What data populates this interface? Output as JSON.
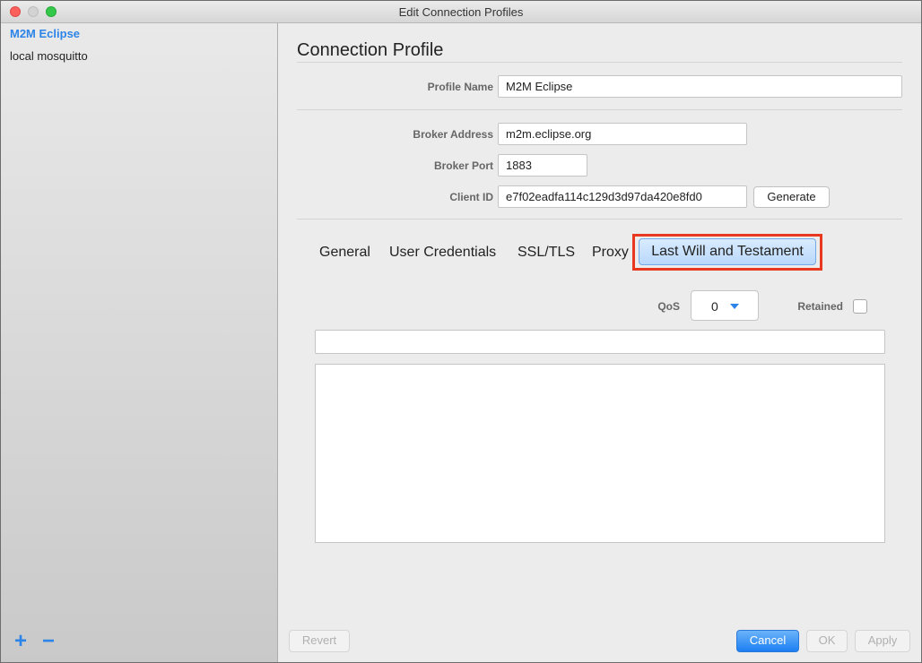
{
  "window": {
    "title": "Edit Connection Profiles"
  },
  "sidebar": {
    "items": [
      {
        "label": "M2M Eclipse",
        "selected": true
      },
      {
        "label": "local mosquitto",
        "selected": false
      }
    ],
    "add_label": "+",
    "remove_label": "−"
  },
  "profile": {
    "heading": "Connection Profile",
    "profile_name_label": "Profile Name",
    "profile_name_value": "M2M Eclipse",
    "broker_address_label": "Broker Address",
    "broker_address_value": "m2m.eclipse.org",
    "broker_port_label": "Broker Port",
    "broker_port_value": "1883",
    "client_id_label": "Client ID",
    "client_id_value": "e7f02eadfa114c129d3d97da420e8fd0",
    "generate_label": "Generate"
  },
  "tabs": {
    "items": [
      "General",
      "User Credentials",
      "SSL/TLS",
      "Proxy",
      "Last Will and Testament"
    ],
    "active": "Last Will and Testament"
  },
  "lwt": {
    "qos_label": "QoS",
    "qos_value": "0",
    "retained_label": "Retained",
    "retained": false,
    "topic_value": "",
    "message_value": ""
  },
  "footer": {
    "revert_label": "Revert",
    "cancel_label": "Cancel",
    "ok_label": "OK",
    "apply_label": "Apply"
  },
  "colors": {
    "accent": "#2d84e8",
    "highlight_border": "#e8381f"
  }
}
